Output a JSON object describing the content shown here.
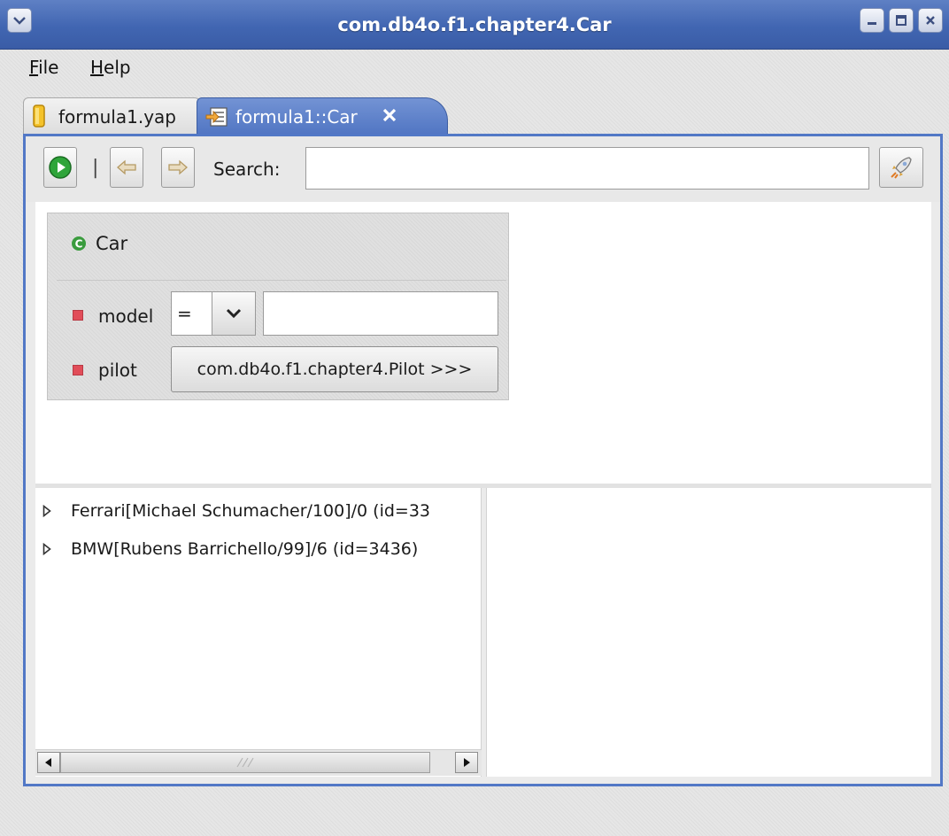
{
  "window": {
    "title": "com.db4o.f1.chapter4.Car",
    "menu_icon": "chevron-down-icon",
    "controls": [
      "minimize-icon",
      "maximize-icon",
      "close-icon"
    ]
  },
  "menubar": {
    "file_first": "F",
    "file_rest": "ile",
    "help_first": "H",
    "help_rest": "elp"
  },
  "tabs": [
    {
      "label": "formula1.yap",
      "icon": "database-icon",
      "active": false
    },
    {
      "label": "formula1::Car",
      "icon": "query-icon",
      "active": true,
      "closable": true
    }
  ],
  "toolbar": {
    "run_icon": "run-icon",
    "separator": "|",
    "back_icon": "back-arrow-icon",
    "forward_icon": "forward-arrow-icon",
    "search_label": "Search:",
    "search_value": "",
    "search_placeholder": "",
    "go_icon": "rocket-icon"
  },
  "query": {
    "class_name": "Car",
    "class_icon": "class-icon",
    "fields": [
      {
        "name": "model",
        "operator": "=",
        "value": ""
      },
      {
        "name": "pilot",
        "link_label": "com.db4o.f1.chapter4.Pilot >>>"
      }
    ]
  },
  "results": [
    {
      "label": "Ferrari[Michael Schumacher/100]/0 (id=33"
    },
    {
      "label": "BMW[Rubens Barrichello/99]/6 (id=3436)"
    }
  ],
  "colors": {
    "accent": "#5278c6",
    "titlebar": "#4166b2",
    "field_marker": "#e14d59"
  }
}
